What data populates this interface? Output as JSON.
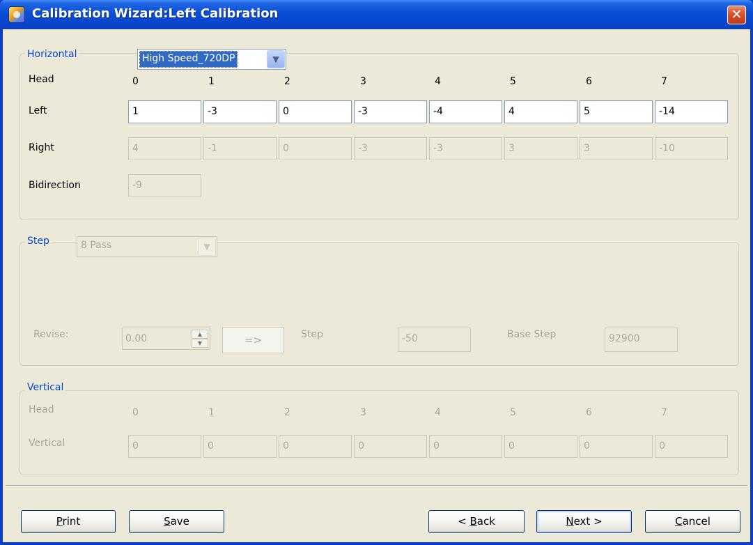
{
  "window": {
    "title": "Calibration Wizard:Left Calibration",
    "close_glyph": "✕",
    "icon": "calibration-app-icon"
  },
  "horizontal": {
    "legend": "Horizontal",
    "mode_selected": "High Speed_720DP",
    "head_label": "Head",
    "heads": [
      "0",
      "1",
      "2",
      "3",
      "4",
      "5",
      "6",
      "7"
    ],
    "left_label": "Left",
    "left_values": [
      "1",
      "-3",
      "0",
      "-3",
      "-4",
      "4",
      "5",
      "-14"
    ],
    "right_label": "Right",
    "right_values": [
      "4",
      "-1",
      "0",
      "-3",
      "-3",
      "3",
      "3",
      "-10"
    ],
    "bidirection_label": "Bidirection",
    "bidirection_value": "-9"
  },
  "step": {
    "legend": "Step",
    "pass_selected": "8 Pass",
    "revise_label": "Revise:",
    "revise_value": "0.00",
    "arrow_button": "=>",
    "step_label": "Step",
    "step_value": "-50",
    "base_step_label": "Base Step",
    "base_step_value": "92900"
  },
  "vertical": {
    "legend": "Vertical",
    "head_label": "Head",
    "heads": [
      "0",
      "1",
      "2",
      "3",
      "4",
      "5",
      "6",
      "7"
    ],
    "vertical_label": "Vertical",
    "vertical_values": [
      "0",
      "0",
      "0",
      "0",
      "0",
      "0",
      "0",
      "0"
    ]
  },
  "buttons": {
    "print_ul": "P",
    "print_rest": "rint",
    "save_ul": "S",
    "save_rest": "ave",
    "back_pre": "< ",
    "back_ul": "B",
    "back_rest": "ack",
    "next_ul": "N",
    "next_rest": "ext >",
    "cancel_ul": "C",
    "cancel_rest": "ancel"
  },
  "colors": {
    "titlebar": "#0a4fd4",
    "legend_text": "#0046d5",
    "dialog_bg": "#ece9d8",
    "close_button": "#d9522e"
  }
}
